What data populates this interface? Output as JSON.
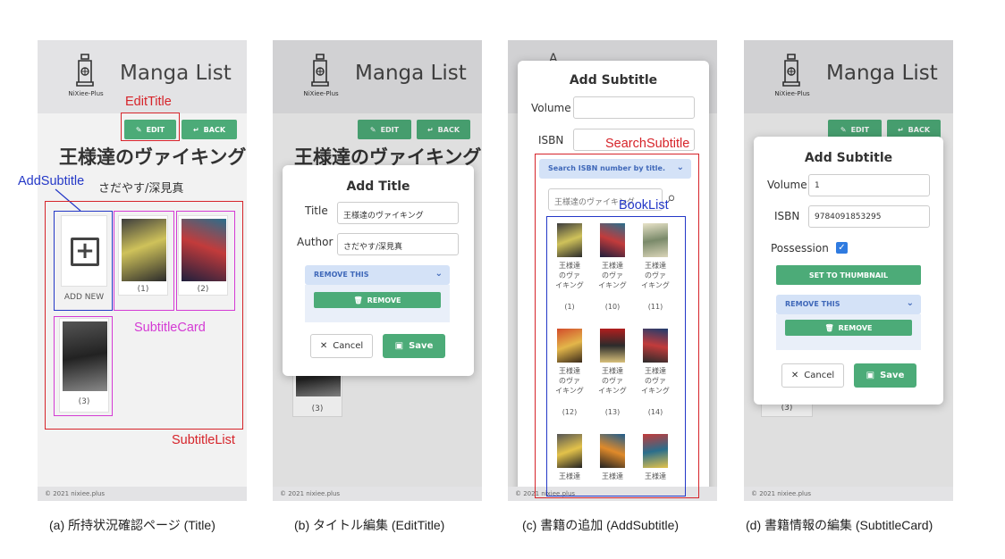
{
  "app": {
    "title": "Manga List",
    "logo_text": "NiXiee-Plus",
    "footer": "© 2021 nixiee.plus"
  },
  "buttons": {
    "edit": "EDIT",
    "back": "BACK"
  },
  "title_page": {
    "title": "王様達のヴァイキング",
    "author": "さだやす/深見真",
    "add_new": "ADD NEW",
    "cards": [
      "(1)",
      "(2)",
      "(3)"
    ]
  },
  "edit_title": {
    "modal_title": "Add Title",
    "title_label": "Title",
    "title_value": "王様達のヴァイキング",
    "author_label": "Author",
    "author_value": "さだやす/深見真",
    "remove_this": "REMOVE THIS",
    "remove": "REMOVE",
    "cancel": "Cancel",
    "save": "Save",
    "bg_card": "(3)"
  },
  "add_subtitle": {
    "modal_title": "Add Subtitle",
    "volume_label": "Volume",
    "isbn_label": "ISBN",
    "search_header": "Search ISBN number by title.",
    "search_value": "王様達のヴァイキング",
    "books": [
      {
        "title": "王様達のヴァイキング",
        "no": "(1)"
      },
      {
        "title": "王様達のヴァイキング",
        "no": "(10)"
      },
      {
        "title": "王様達のヴァイキング",
        "no": "(11)"
      },
      {
        "title": "王様達のヴァイキング",
        "no": "(12)"
      },
      {
        "title": "王様達のヴァイキング",
        "no": "(13)"
      },
      {
        "title": "王様達のヴァイキング",
        "no": "(14)"
      },
      {
        "title": "王様達",
        "no": ""
      },
      {
        "title": "王様達",
        "no": ""
      },
      {
        "title": "王様達",
        "no": ""
      }
    ],
    "partial_char": "A"
  },
  "subtitle_card": {
    "modal_title": "Add Subtitle",
    "volume_label": "Volume",
    "volume_value": "1",
    "isbn_label": "ISBN",
    "isbn_value": "9784091853295",
    "possession_label": "Possession",
    "thumbnail": "SET TO THUMBNAIL",
    "remove_this": "REMOVE THIS",
    "remove": "REMOVE",
    "cancel": "Cancel",
    "save": "Save",
    "bg_card": "(3)"
  },
  "annotations": {
    "edit_title": "EditTitle",
    "add_subtitle": "AddSubtitle",
    "subtitle_card": "SubtitleCard",
    "subtitle_list": "SubtitleList",
    "search_subtitle": "SearchSubtitle",
    "book_list": "BookList"
  },
  "captions": {
    "a": "(a) 所持状況確認ページ (Title)",
    "b": "(b) タイトル編集 (EditTitle)",
    "c": "(c) 書籍の追加 (AddSubtitle)",
    "d": "(d) 書籍情報の編集 (SubtitleCard)"
  },
  "colors": {
    "green": "#4cab78",
    "annotation_red": "#d6242a",
    "annotation_blue": "#2438c7",
    "annotation_magenta": "#d43ad4",
    "collapse_blue": "#d4e2f7"
  },
  "icons": [
    "lantern-logo-icon",
    "edit-icon",
    "back-icon",
    "plus-icon",
    "chevron-down-icon",
    "trash-icon",
    "close-icon",
    "save-icon",
    "search-icon",
    "check-icon"
  ]
}
